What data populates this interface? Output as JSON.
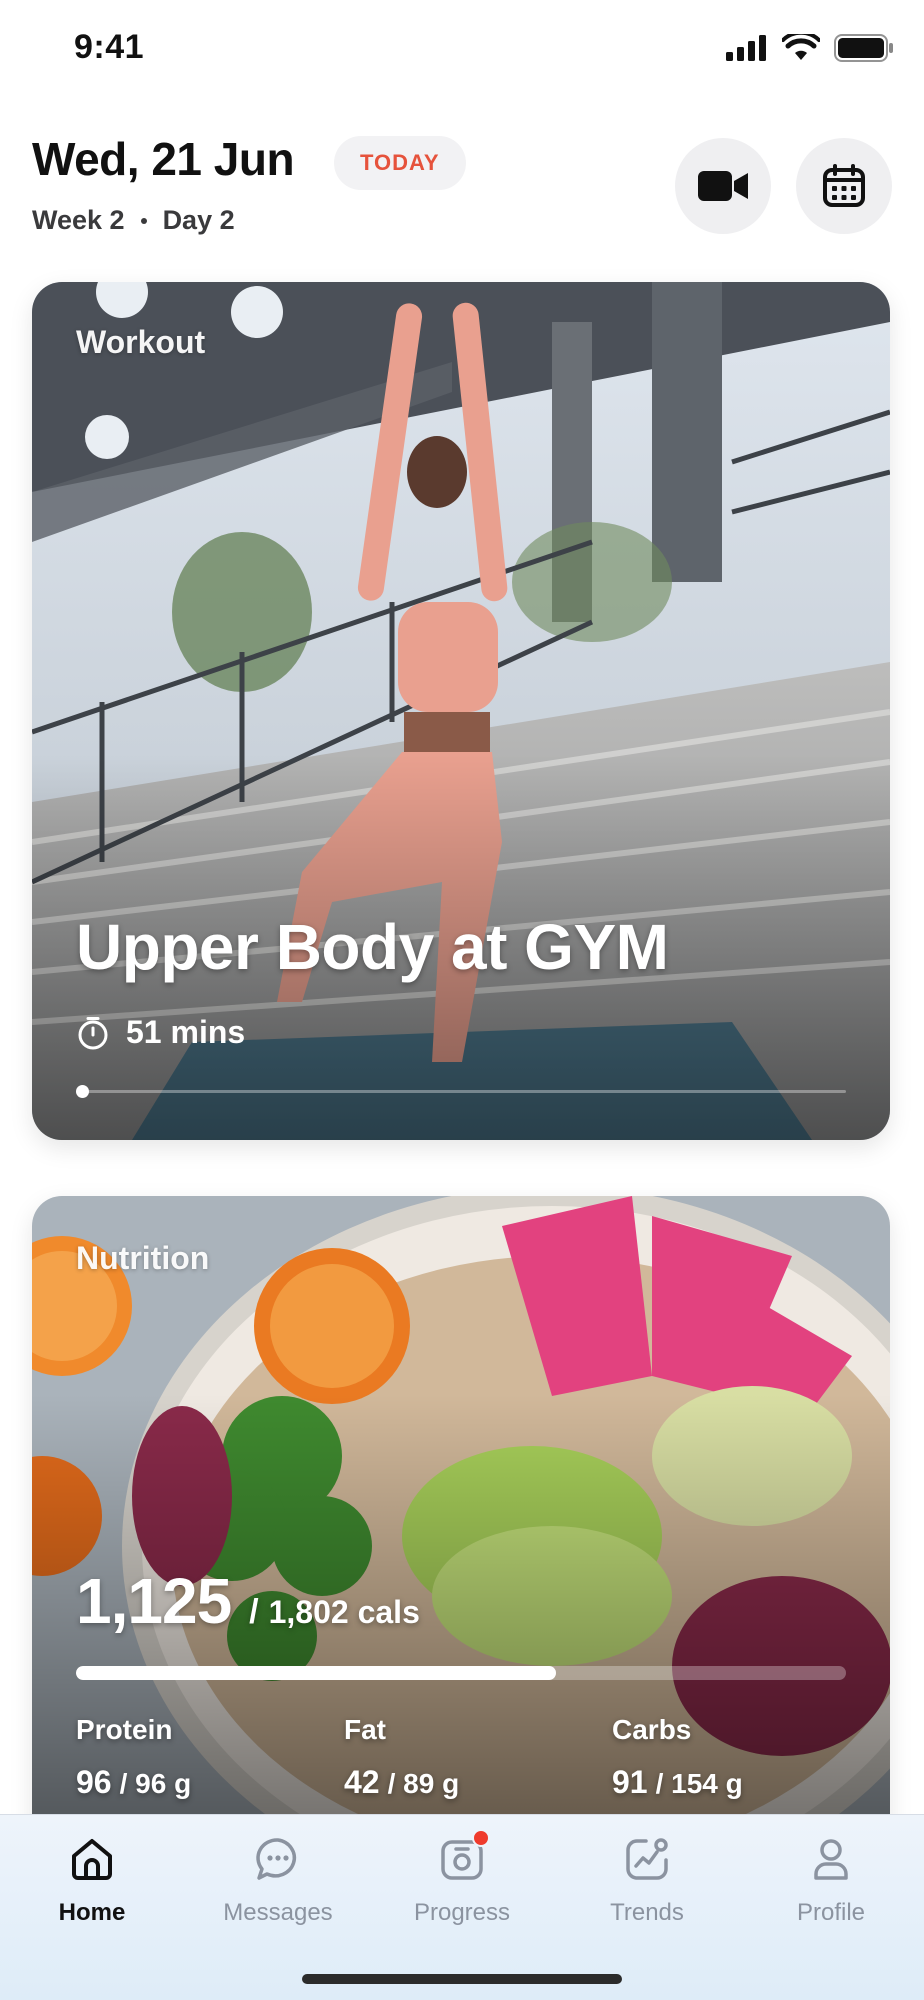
{
  "status_bar": {
    "time": "9:41"
  },
  "header": {
    "date": "Wed, 21 Jun",
    "today_label": "TODAY",
    "week": "Week 2",
    "day": "Day 2"
  },
  "workout": {
    "section_label": "Workout",
    "title": "Upper Body at GYM",
    "duration": "51 mins",
    "progress": 0
  },
  "nutrition": {
    "section_label": "Nutrition",
    "calories_eaten": "1,125",
    "calories_target": "1,802 cals",
    "calories_fraction": 0.624,
    "macros": [
      {
        "name": "Protein",
        "value": "96",
        "target": "96 g"
      },
      {
        "name": "Fat",
        "value": "42",
        "target": "89 g"
      },
      {
        "name": "Carbs",
        "value": "91",
        "target": "154 g"
      }
    ]
  },
  "tabs": [
    {
      "label": "Home",
      "icon": "home-icon",
      "active": true
    },
    {
      "label": "Messages",
      "icon": "chat-icon",
      "active": false
    },
    {
      "label": "Progress",
      "icon": "progress-camera-icon",
      "active": false,
      "badge": true
    },
    {
      "label": "Trends",
      "icon": "trends-icon",
      "active": false
    },
    {
      "label": "Profile",
      "icon": "profile-icon",
      "active": false
    }
  ],
  "colors": {
    "today_text": "#e6533c",
    "badge_red": "#ef3b2d",
    "tab_inactive": "#8b93a0"
  }
}
